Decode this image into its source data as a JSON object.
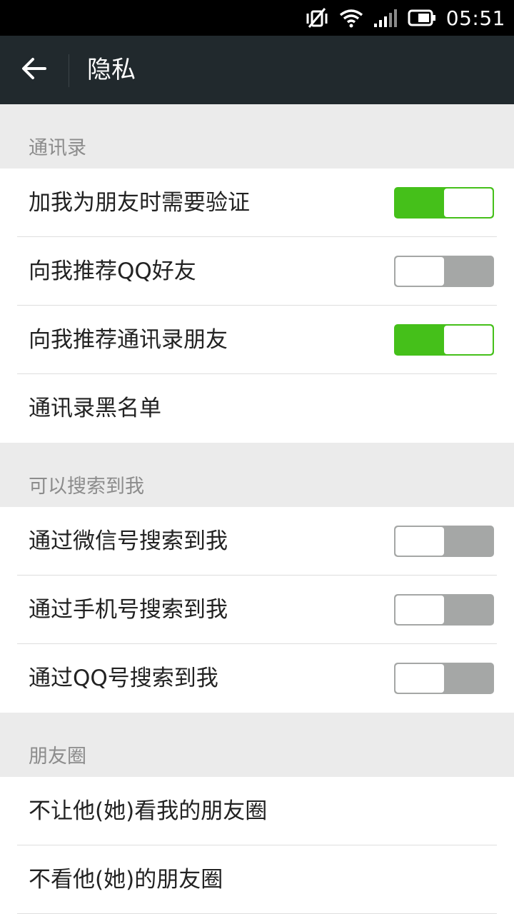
{
  "status_bar": {
    "time": "05:51",
    "icons": [
      "vibrate-off-icon",
      "wifi-icon",
      "signal-icon",
      "battery-icon"
    ]
  },
  "app_bar": {
    "back_icon": "arrow-left-icon",
    "title": "隐私"
  },
  "sections": [
    {
      "header": "通讯录",
      "rows": [
        {
          "label": "加我为朋友时需要验证",
          "toggle": true
        },
        {
          "label": "向我推荐QQ好友",
          "toggle": false
        },
        {
          "label": "向我推荐通讯录朋友",
          "toggle": true
        },
        {
          "label": "通讯录黑名单"
        }
      ]
    },
    {
      "header": "可以搜索到我",
      "rows": [
        {
          "label": "通过微信号搜索到我",
          "toggle": false
        },
        {
          "label": "通过手机号搜索到我",
          "toggle": false
        },
        {
          "label": "通过QQ号搜索到我",
          "toggle": false
        }
      ]
    },
    {
      "header": "朋友圈",
      "rows": [
        {
          "label": "不让他(她)看我的朋友圈"
        },
        {
          "label": "不看他(她)的朋友圈"
        }
      ]
    }
  ],
  "colors": {
    "toggle_on": "#45c01a",
    "toggle_off": "#a5a7a6",
    "app_bar": "#21292d",
    "background": "#ebebeb"
  }
}
